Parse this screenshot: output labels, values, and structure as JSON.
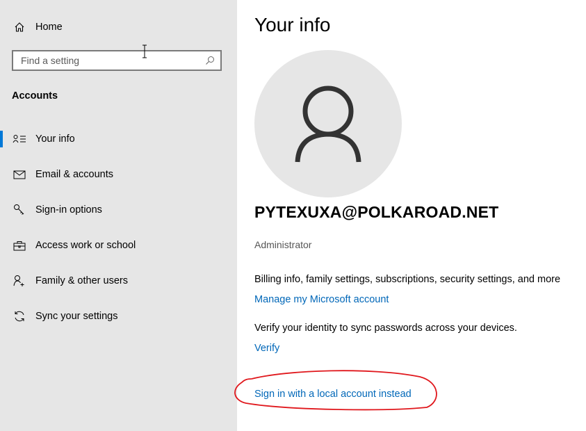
{
  "sidebar": {
    "home_label": "Home",
    "search": {
      "placeholder": "Find a setting",
      "value": ""
    },
    "section_title": "Accounts",
    "items": [
      {
        "label": "Your info",
        "icon": "person-card-icon",
        "selected": true
      },
      {
        "label": "Email & accounts",
        "icon": "mail-icon"
      },
      {
        "label": "Sign-in options",
        "icon": "key-icon"
      },
      {
        "label": "Access work or school",
        "icon": "briefcase-icon"
      },
      {
        "label": "Family & other users",
        "icon": "person-add-icon"
      },
      {
        "label": "Sync your settings",
        "icon": "sync-icon"
      }
    ]
  },
  "main": {
    "title": "Your info",
    "account_email": "PYTEXUXA@POLKAROAD.NET",
    "role": "Administrator",
    "billing_text": "Billing info, family settings, subscriptions, security settings, and more",
    "manage_link": "Manage my Microsoft account",
    "verify_text": "Verify your identity to sync passwords across your devices.",
    "verify_link": "Verify",
    "local_account_link": "Sign in with a local account instead"
  },
  "colors": {
    "accent": "#0078d7",
    "link": "#0067b8",
    "sidebar_bg": "#e6e6e6",
    "annotation": "#e0171c"
  }
}
